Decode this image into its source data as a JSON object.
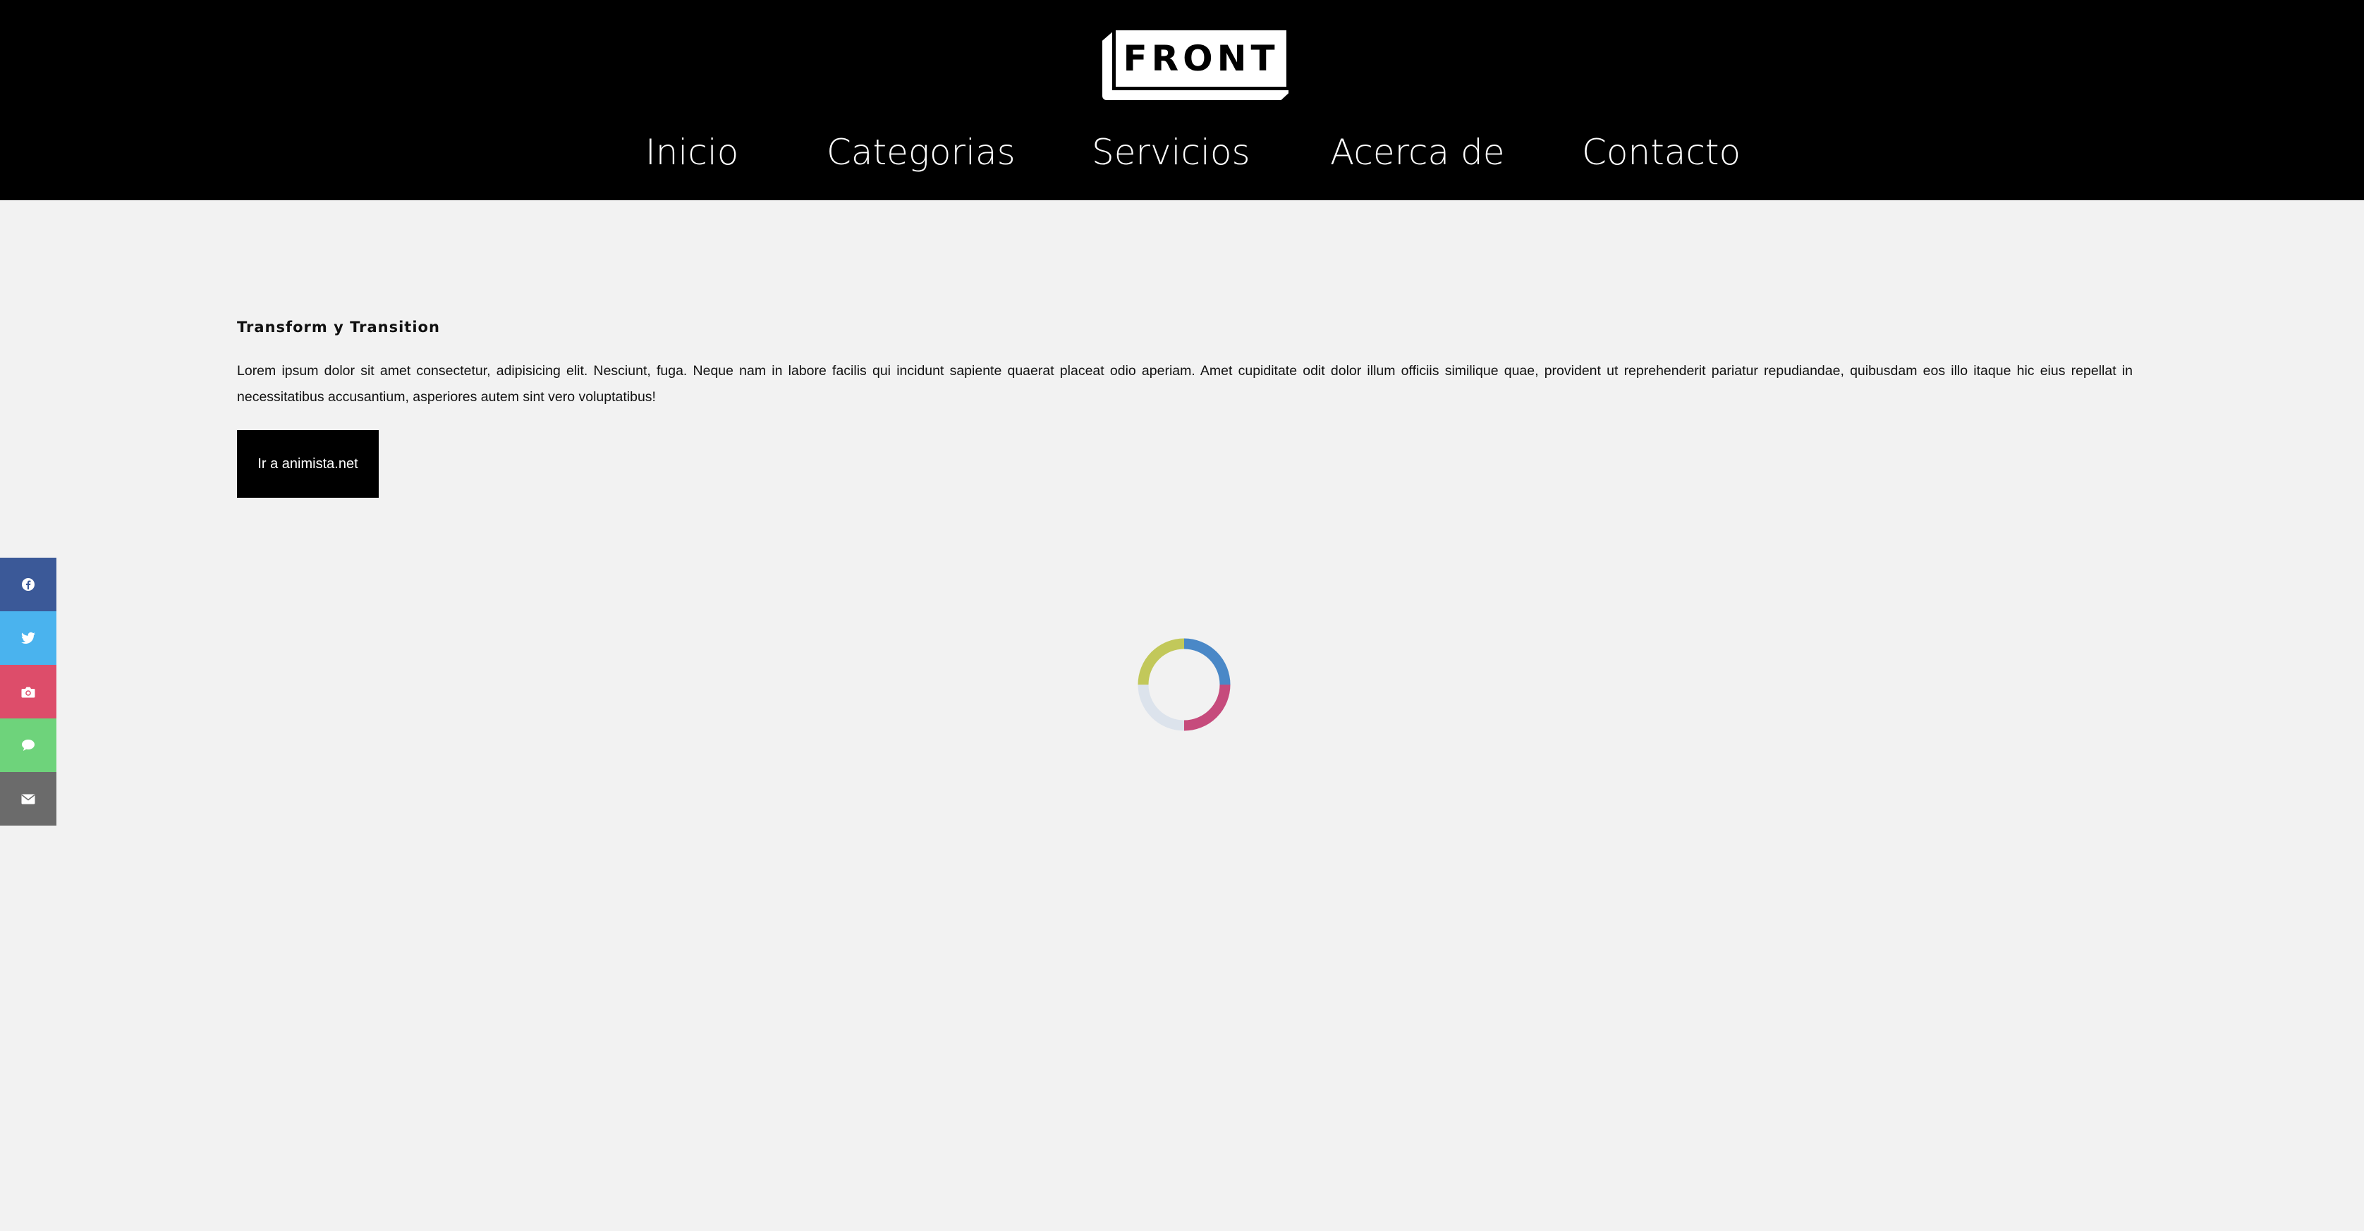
{
  "header": {
    "logo_text": "FRONT",
    "nav": [
      {
        "label": "Inicio"
      },
      {
        "label": "Categorias"
      },
      {
        "label": "Servicios"
      },
      {
        "label": "Acerca de"
      },
      {
        "label": "Contacto"
      }
    ]
  },
  "main": {
    "title": "Transform y Transition",
    "body": "Lorem ipsum dolor sit amet consectetur, adipisicing elit. Nesciunt, fuga. Neque nam in labore facilis qui incidunt sapiente quaerat placeat odio aperiam. Amet cupiditate odit dolor illum officiis similique quae, provident ut reprehenderit pariatur repudiandae, quibusdam eos illo itaque hic eius repellat in necessitatibus accusantium, asperiores autem sint vero voluptatibus!",
    "button_label": "Ir a animista.net",
    "spinner_colors": [
      "#4a88c7",
      "#c64b7c",
      "#dce3ec",
      "#c2c85a"
    ]
  },
  "social": [
    {
      "icon": "facebook-icon",
      "color": "#3b5998"
    },
    {
      "icon": "twitter-icon",
      "color": "#4ab3ee"
    },
    {
      "icon": "camera-icon",
      "color": "#dd4d6a"
    },
    {
      "icon": "chat-icon",
      "color": "#6ed37b"
    },
    {
      "icon": "envelope-icon",
      "color": "#6b6b6b"
    }
  ]
}
